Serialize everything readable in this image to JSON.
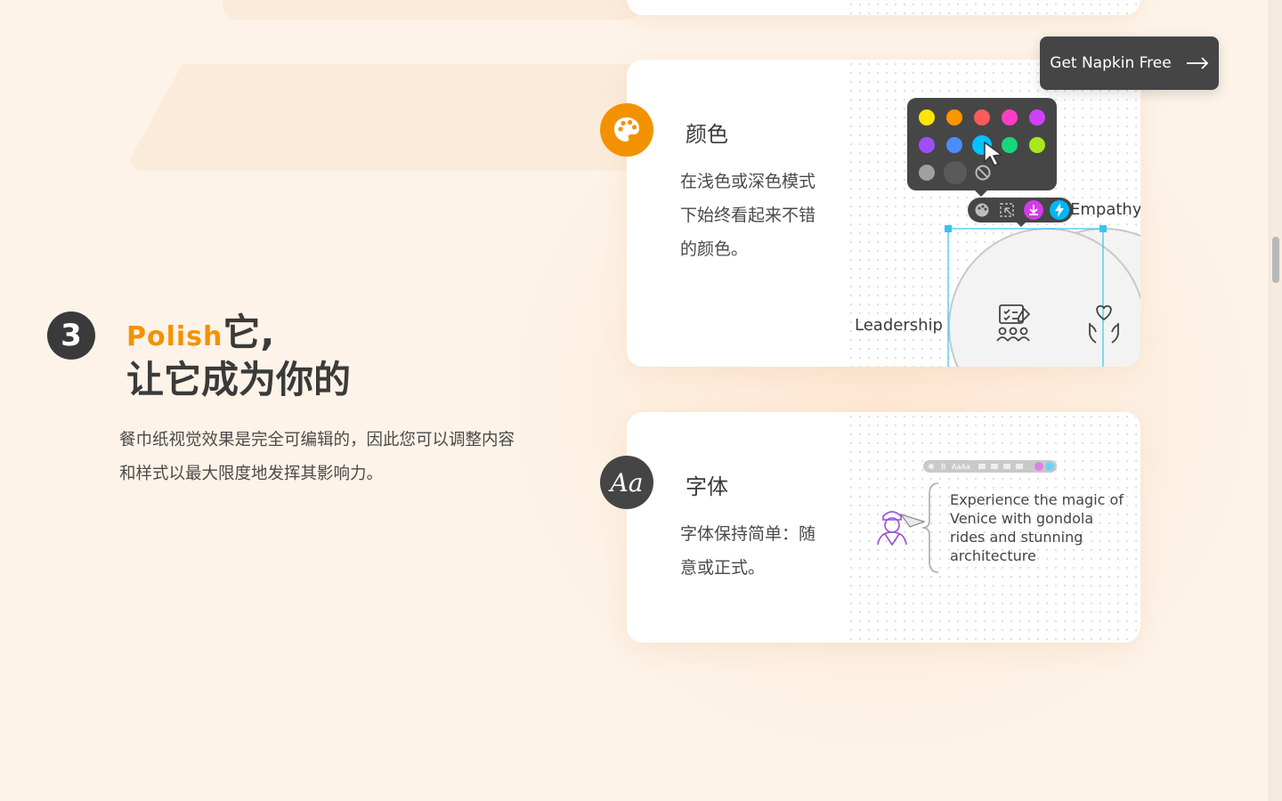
{
  "cta": {
    "label": "Get Napkin Free"
  },
  "step": {
    "number": "3",
    "title_highlight": "Polish",
    "title_line1_rest": "它,",
    "title_line2": "让它成为你的",
    "description": "餐巾纸视觉效果是完全可编辑的，因此您可以调整内容和样式以最大限度地发挥其影响力。"
  },
  "features": {
    "colors": {
      "icon": "palette-icon",
      "title": "颜色",
      "description": "在浅色或深色模式下始终看起来不错的颜色。",
      "demo": {
        "label_right": "Empathy",
        "label_left": "Leadership",
        "swatches": [
          "#ffe600",
          "#ff9500",
          "#ff5a5a",
          "#ff3ec5",
          "#d240ff",
          "#a04dff",
          "#4b8dff",
          "#00c2ff",
          "#18d67a",
          "#a8e81e",
          "#a0a0a0",
          "#5a5a5a"
        ]
      }
    },
    "fonts": {
      "icon": "font-aa-icon",
      "icon_text": "Aa",
      "title": "字体",
      "description": "字体保持简单：随意或正式。",
      "demo": {
        "text": "Experience the magic of Venice with gondola rides and stunning architecture"
      }
    }
  },
  "colors": {
    "accent": "#f39200",
    "dark": "#3a3a3a",
    "background": "#fdf3e8"
  }
}
